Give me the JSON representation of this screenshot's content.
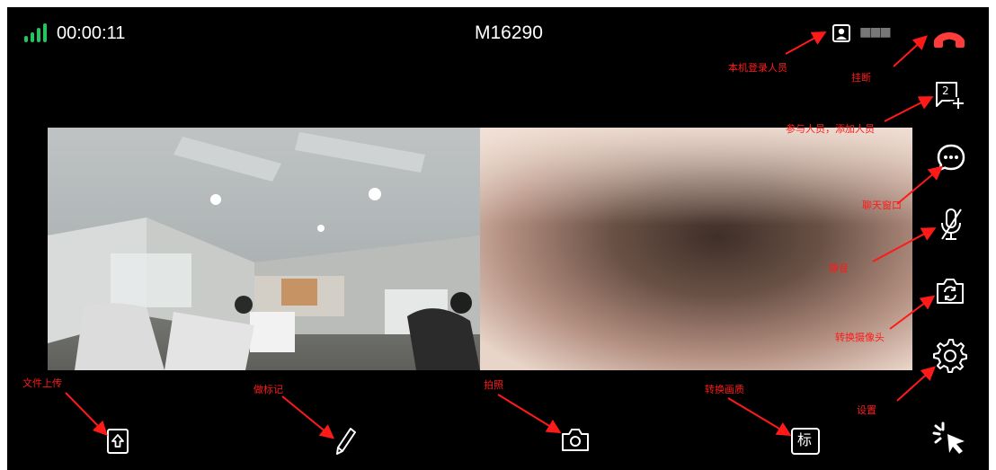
{
  "status": {
    "signal_icon": "signal-bars-icon",
    "timer": "00:00:11",
    "meeting_id": "M16290",
    "local_user_name": "■■■"
  },
  "toolbar_right": {
    "hangup": "hangup-icon",
    "participants_count": "2",
    "chat": "chat-icon",
    "mute": "mic-muted-icon",
    "switch_camera": "switch-camera-icon",
    "settings": "gear-icon",
    "pointer": "pointer-icon"
  },
  "toolbar_bottom": {
    "upload": "upload-file-icon",
    "mark": "pencil-icon",
    "photo": "camera-icon",
    "quality_label": "标"
  },
  "annotations": {
    "local_user": "本机登录人员",
    "hangup": "挂断",
    "participants": "参与人员，添加人员",
    "chat": "聊天窗口",
    "mute": "静音",
    "switch_camera": "转换摄像头",
    "settings": "设置",
    "upload": "文件上传",
    "mark": "做标记",
    "photo": "拍照",
    "quality": "转换画质"
  },
  "colors": {
    "background": "#000000",
    "hangup": "#ff3b3b",
    "signal": "#22c55e",
    "annotation": "#ff1a1a"
  }
}
